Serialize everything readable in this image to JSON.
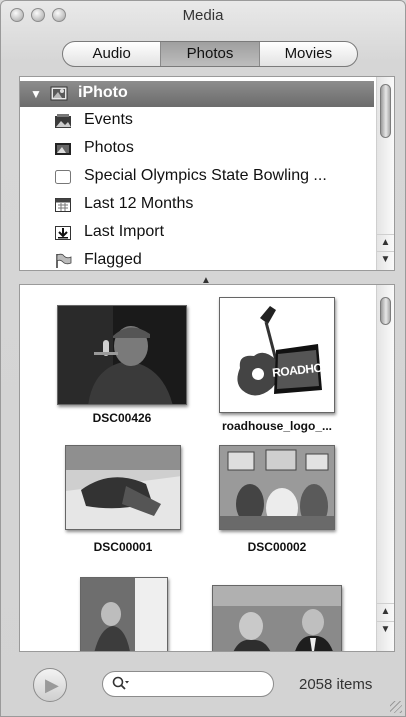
{
  "window": {
    "title": "Media"
  },
  "tabs": [
    {
      "label": "Audio",
      "selected": false
    },
    {
      "label": "Photos",
      "selected": true
    },
    {
      "label": "Movies",
      "selected": false
    }
  ],
  "source_list": {
    "header": {
      "label": "iPhoto",
      "icon": "iphoto-icon",
      "expanded": true
    },
    "items": [
      {
        "label": "Events",
        "icon": "events-icon"
      },
      {
        "label": "Photos",
        "icon": "photos-icon"
      },
      {
        "label": "Special Olympics State Bowling ...",
        "icon": "album-icon"
      },
      {
        "label": "Last 12 Months",
        "icon": "calendar-icon"
      },
      {
        "label": "Last Import",
        "icon": "import-icon"
      },
      {
        "label": "Flagged",
        "icon": "flag-icon"
      }
    ]
  },
  "photos": [
    {
      "caption": "DSC00426"
    },
    {
      "caption": "roadhouse_logo_..."
    },
    {
      "caption": "DSC00001"
    },
    {
      "caption": "DSC00002"
    },
    {
      "caption": ""
    },
    {
      "caption": ""
    }
  ],
  "logo_text": "ROADHOUSE",
  "search": {
    "placeholder": ""
  },
  "status": {
    "item_count": "2058 items"
  },
  "colors": {
    "selection": "#7a7a7a",
    "window_bg": "#d6d6d6"
  }
}
